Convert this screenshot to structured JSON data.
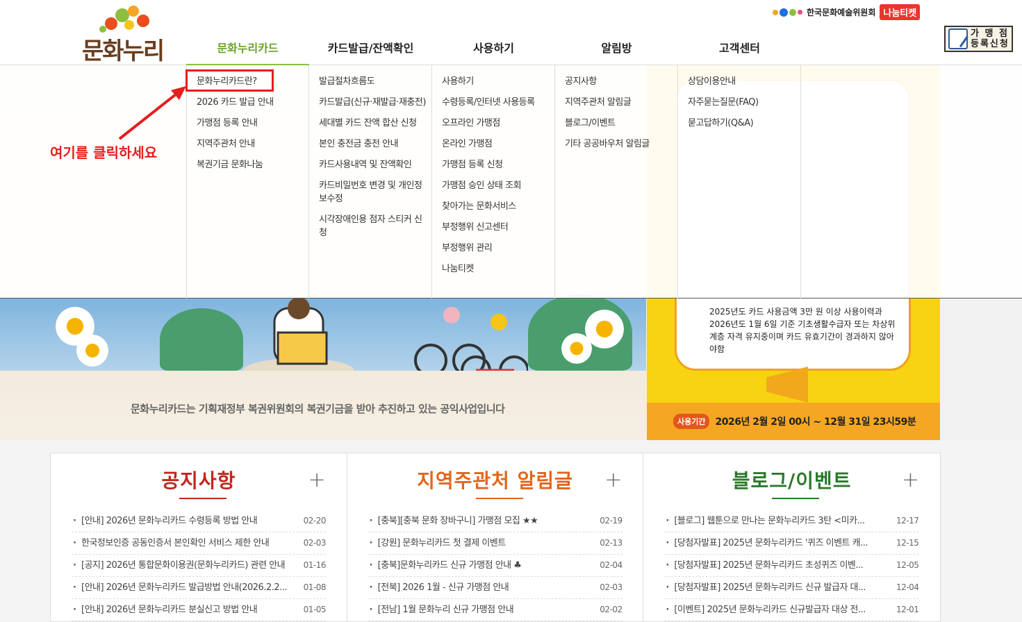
{
  "header": {
    "logo_text": "문화누리",
    "org_name": "한국문화예술위원회",
    "nanum_ticket": "나눔티켓",
    "register_btn": "가맹점\n등록신청",
    "register_line1": "가 맹 점",
    "register_line2": "등록신청",
    "nav": [
      "문화누리카드",
      "카드발급/잔액확인",
      "사용하기",
      "알림방",
      "고객센터"
    ],
    "active_nav": "문화누리카드"
  },
  "dropdown": {
    "col1": [
      "문화누리카드란?",
      "2026 카드 발급 안내",
      "가맹점 등록 안내",
      "지역주관처 안내",
      "복권기금 문화나눔"
    ],
    "col2": [
      "발급절차흐름도",
      "카드발급(신규·재발급·재충전)",
      "세대별 카드 잔액 합산 신청",
      "본인 충전금 충전 안내",
      "카드사용내역 및 잔액확인",
      "카드비밀번호 변경 및 개인정보수정",
      "시각장애인용 점자 스티커 신청"
    ],
    "col3": [
      "사용하기",
      "수령등록/인터넷 사용등록",
      "오프라인 가맹점",
      "온라인 가맹점",
      "가맹점 등록 신청",
      "가맹점 승인 상태 조회",
      "찾아가는 문화서비스",
      "부정행위 신고센터",
      "부정행위 관리",
      "나눔티켓"
    ],
    "col4": [
      "공지사항",
      "지역주관처 알림글",
      "블로그/이벤트",
      "기타 공공바우처 알림글"
    ],
    "col5": [
      "상담이용안내",
      "자주묻는질문(FAQ)",
      "묻고답하기(Q&A)"
    ],
    "callout": "여기를 클릭하세요"
  },
  "hero": {
    "caption": "문화누리카드는 기획재정부 복권위원회의 복권기금을 받아 추진하고 있는 공익사업입니다",
    "notice_text": "2025년도 카드 사용금액 3만 원 이상 사용이력과 2026년도 1월 6일 기준 기초생활수급자 또는 차상위계층 자격 유지중이며 카드 유효기간이 경과하지 않아야함",
    "period_tag": "사용기간",
    "period_text": "2026년 2월 2일 00시 ~ 12월 31일 23시59분"
  },
  "boards": [
    {
      "title": "공지사항",
      "color": "#c0281f",
      "items": [
        {
          "t": "[안내] 2026년 문화누리카드 수령등록 방법 안내",
          "d": "02-20"
        },
        {
          "t": "한국정보인증 공동인증서 본인확인 서비스 제한 안내",
          "d": "02-03"
        },
        {
          "t": "[공지] 2026년 통합문화이용권(문화누리카드) 관련 안내",
          "d": "01-16"
        },
        {
          "t": "[안내] 2026년 문화누리카드 발급방법 안내(2026.2.2...",
          "d": "01-08"
        },
        {
          "t": "[안내] 2026년 문화누리카드 분실신고 방법 안내",
          "d": "01-05"
        }
      ]
    },
    {
      "title": "지역주관처 알림글",
      "color": "#e2661b",
      "items": [
        {
          "t": "[충북][충북 문화 장바구니] 가맹점 모집 ★★",
          "d": "02-19"
        },
        {
          "t": "[강원] 문화누리카드 첫 결제 이벤트",
          "d": "02-13"
        },
        {
          "t": "[충북]문화누리카드 신규 가맹점 안내 ♣",
          "d": "02-04"
        },
        {
          "t": "[전북] 2026 1월 - 신규 가맹점 안내",
          "d": "02-03"
        },
        {
          "t": "[전남] 1월 문화누리 신규 가맹점 안내",
          "d": "02-02"
        }
      ]
    },
    {
      "title": "블로그/이벤트",
      "color": "#2a7a2a",
      "items": [
        {
          "t": "[블로그] 웹툰으로 만나는 문화누리카드 3탄 <미카...",
          "d": "12-17"
        },
        {
          "t": "[당첨자발표] 2025년 문화누리카드 '퀴즈 이벤트 캐...",
          "d": "12-15"
        },
        {
          "t": "[당첨자발표] 2025년 문화누리카드 초성퀴즈 이벤...",
          "d": "12-05"
        },
        {
          "t": "[당첨자발표] 2025년 문화누리카드 신규 발급자 대...",
          "d": "12-04"
        },
        {
          "t": "[이벤트] 2025년 문화누리카드 신규발급자 대상 전...",
          "d": "12-01"
        }
      ]
    }
  ]
}
